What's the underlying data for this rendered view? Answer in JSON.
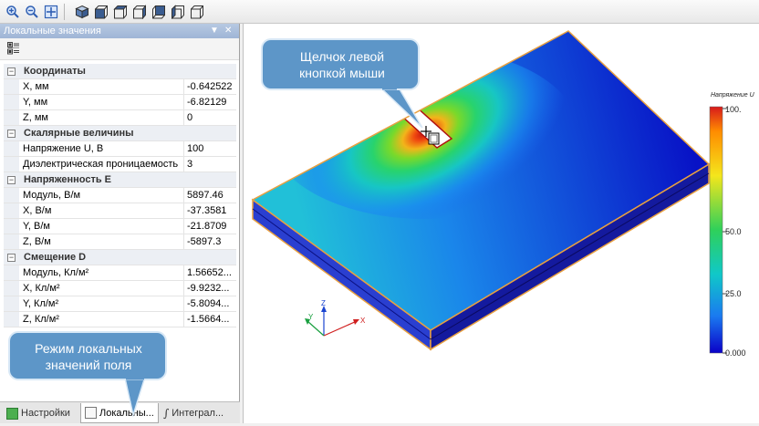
{
  "toolbar": {
    "buttons": [
      "zoom-in-icon",
      "zoom-out-icon",
      "zoom-fit-icon",
      "view-iso-icon",
      "view-front-icon",
      "view-back-icon",
      "view-left-icon",
      "view-right-icon",
      "view-top-icon",
      "view-bottom-icon"
    ]
  },
  "panel": {
    "title": "Локальные значения",
    "pin": "▼",
    "close": "✕",
    "categories": [
      {
        "title": "Координаты",
        "rows": [
          {
            "name": "X, мм",
            "value": "-0.642522"
          },
          {
            "name": "Y, мм",
            "value": "-6.82129"
          },
          {
            "name": "Z, мм",
            "value": "0"
          }
        ]
      },
      {
        "title": "Скалярные величины",
        "rows": [
          {
            "name": "Напряжение U, В",
            "value": "100"
          },
          {
            "name": "Диэлектрическая проницаемость",
            "value": "3"
          }
        ]
      },
      {
        "title": "Напряженность E",
        "rows": [
          {
            "name": "Модуль, В/м",
            "value": "5897.46"
          },
          {
            "name": "X, В/м",
            "value": "-37.3581"
          },
          {
            "name": "Y, В/м",
            "value": "-21.8709"
          },
          {
            "name": "Z, В/м",
            "value": "-5897.3"
          }
        ]
      },
      {
        "title": "Смещение D",
        "rows": [
          {
            "name": "Модуль, Кл/м²",
            "value": "1.56652..."
          },
          {
            "name": "X, Кл/м²",
            "value": "-9.9232..."
          },
          {
            "name": "Y, Кл/м²",
            "value": "-5.8094..."
          },
          {
            "name": "Z, Кл/м²",
            "value": "-1.5664..."
          }
        ]
      }
    ]
  },
  "tabs": [
    {
      "label": "Настройки",
      "active": false
    },
    {
      "label": "Локальны...",
      "active": true
    },
    {
      "label": "Интеграл...",
      "active": false
    }
  ],
  "callouts": {
    "top": "Щелчок левой кнопкой мыши",
    "bottom": "Режим локальных значений поля"
  },
  "colorbar": {
    "title": "Напряжение U",
    "ticks": [
      "100.",
      "50.0",
      "25.0",
      "0.000"
    ],
    "colors": [
      "#d7191c",
      "#ff8c00",
      "#f4e61c",
      "#2fd05a",
      "#10c8c8",
      "#1a7af0",
      "#0a00c8"
    ]
  },
  "axes": {
    "x": "X",
    "y": "Y",
    "z": "Z"
  }
}
